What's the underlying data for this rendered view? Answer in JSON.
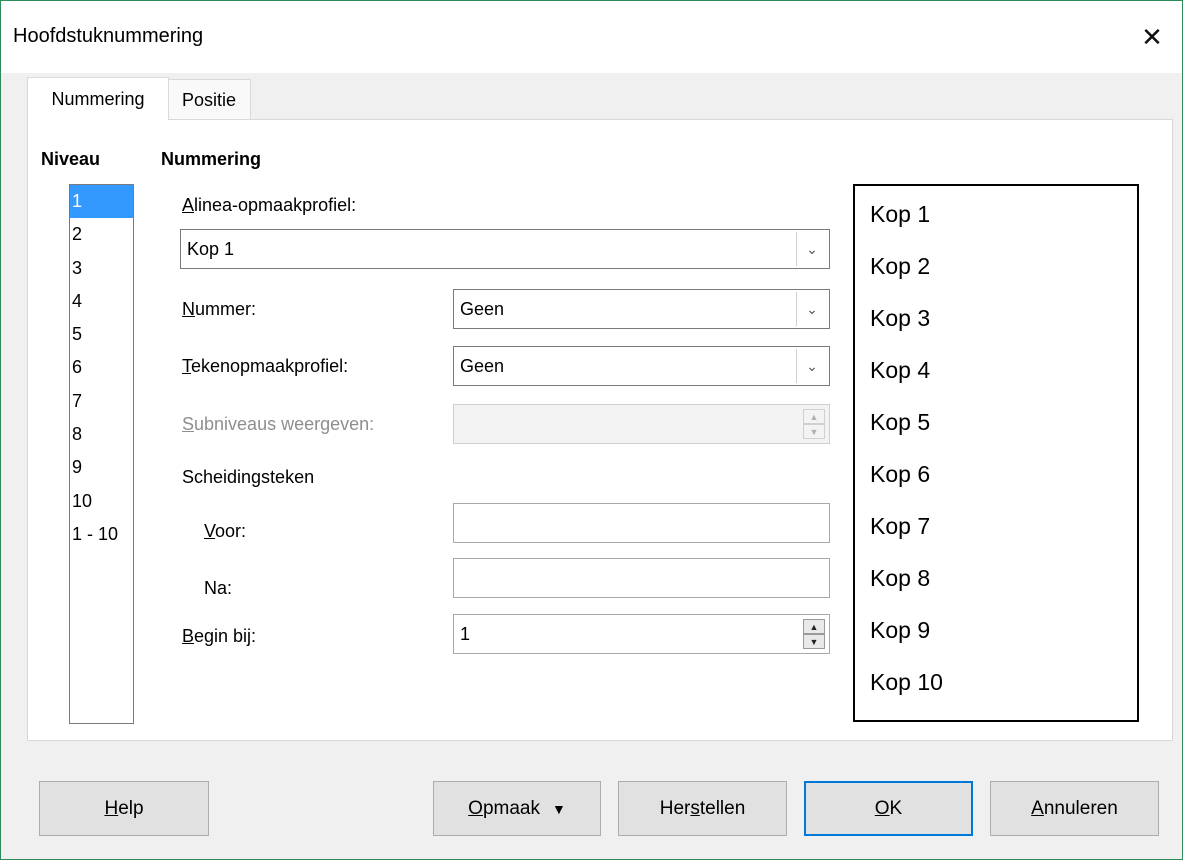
{
  "window": {
    "title": "Hoofdstuknummering",
    "close": "✕"
  },
  "tabs": [
    {
      "label": "Nummering"
    },
    {
      "label": "Positie"
    }
  ],
  "level": {
    "header": "Niveau",
    "items": [
      "1",
      "2",
      "3",
      "4",
      "5",
      "6",
      "7",
      "8",
      "9",
      "10",
      "1 - 10"
    ],
    "selected": "1"
  },
  "numbering": {
    "header": "Nummering",
    "paragraph_style_label": "Alinea-opmaakprofiel:",
    "paragraph_style_value": "Kop 1",
    "number_label": "Nummer:",
    "number_value": "Geen",
    "char_style_label": "Tekenopmaakprofiel:",
    "char_style_value": "Geen",
    "sublevels_label": "Subniveaus weergeven:",
    "sublevels_value": "",
    "separator_label": "Scheidingsteken",
    "before_label": "Voor:",
    "before_value": "",
    "after_label": "Na:",
    "after_value": "",
    "start_label": "Begin bij:",
    "start_value": "1"
  },
  "preview": {
    "items": [
      "Kop 1",
      "Kop 2",
      "Kop 3",
      "Kop 4",
      "Kop 5",
      "Kop 6",
      "Kop 7",
      "Kop 8",
      "Kop 9",
      "Kop 10"
    ]
  },
  "buttons": {
    "help": "Help",
    "format": "Opmaak",
    "reset": "Herstellen",
    "ok": "OK",
    "cancel": "Annuleren"
  }
}
